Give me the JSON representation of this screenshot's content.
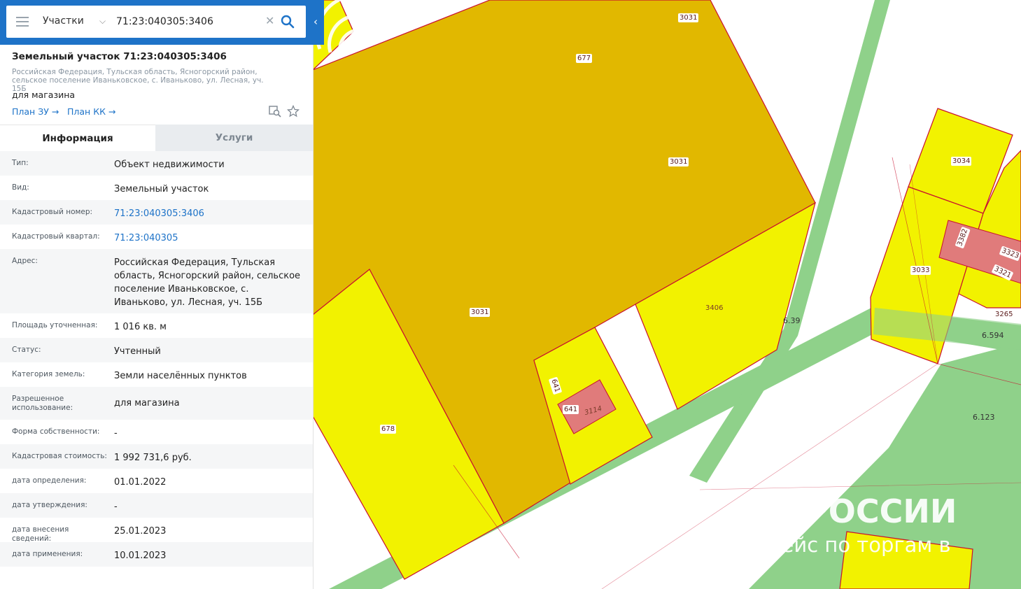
{
  "search": {
    "category": "Участки",
    "query": "71:23:040305:3406"
  },
  "object": {
    "title": "Земельный участок 71:23:040305:3406",
    "address": "Российская Федерация, Тульская область, Ясногорский район, сельское поселение Иваньковское, с. Иваньково, ул. Лесная, уч. 15Б",
    "purpose": "для магазина",
    "plan_zu": "План ЗУ →",
    "plan_kk": "План КК →"
  },
  "tabs": [
    "Информация",
    "Услуги"
  ],
  "info_rows": [
    {
      "label": "Тип:",
      "value": "Объект недвижимости"
    },
    {
      "label": "Вид:",
      "value": "Земельный участок"
    },
    {
      "label": "Кадастровый номер:",
      "value": "71:23:040305:3406"
    },
    {
      "label": "Кадастровый квартал:",
      "value": "71:23:040305"
    },
    {
      "label": "Адрес:",
      "value": "Российская Федерация, Тульская область, Ясногорский район, сельское поселение Иваньковское, с. Иваньково, ул. Лесная, уч. 15Б"
    },
    {
      "label": "Площадь уточненная:",
      "value": "1 016 кв. м"
    },
    {
      "label": "Статус:",
      "value": "Учтенный"
    },
    {
      "label": "Категория земель:",
      "value": "Земли населённых пунктов"
    },
    {
      "label": "Разрешенное использование:",
      "value": "для магазина"
    },
    {
      "label": "Форма собственности:",
      "value": "-"
    },
    {
      "label": "Кадастровая стоимость:",
      "value": "1 992 731,6 руб."
    },
    {
      "label": "дата определения:",
      "value": "01.01.2022"
    },
    {
      "label": "дата утверждения:",
      "value": "-"
    },
    {
      "label": "дата внесения сведений:",
      "value": "25.01.2023"
    },
    {
      "label": "дата применения:",
      "value": "10.01.2023"
    }
  ],
  "map": {
    "labels": {
      "p3031a": "3031",
      "p677": "677",
      "p3031b": "3031",
      "p3031c": "3031",
      "p678": "678",
      "p641a": "641",
      "p641b": "641",
      "p3114": "3114",
      "p3406": "3406",
      "p3034": "3034",
      "p3033": "3033",
      "p3382": "3382",
      "p3323": "3323",
      "p3321": "3321",
      "p3265": "3265",
      "z639": "6.39",
      "z6594": "6.594",
      "z6123": "6.123"
    },
    "watermark_title": "РОССИИ",
    "watermark_subtitle": "лейс по торгам в"
  },
  "colors": {
    "header_blue": "#1e73c8",
    "plot_yellow": "#f2f200",
    "plot_ochre": "#e1b800",
    "building_pink": "#e07b7b",
    "zone_green": "#8fd18a",
    "border_red": "#c8102e"
  }
}
